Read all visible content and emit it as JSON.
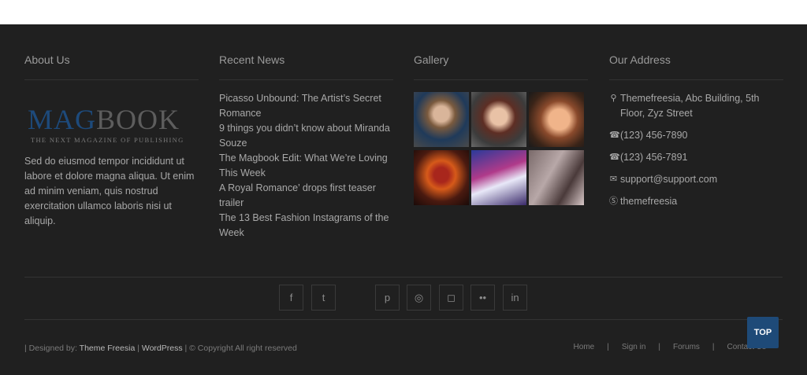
{
  "about": {
    "title": "About Us",
    "logo": {
      "part1": "MAG",
      "part2": "BOOK",
      "tagline": "THE NEXT MAGAZINE OF PUBLISHING"
    },
    "text": "Sed do eiusmod tempor incididunt ut labore et dolore magna aliqua. Ut enim ad minim veniam, quis nostrud exercitation ullamco laboris nisi ut aliquip."
  },
  "news": {
    "title": "Recent News",
    "items": [
      "Picasso Unbound: The Artist’s Secret Romance",
      "9 things you didn’t know about Miranda Souze",
      "The Magbook Edit: What We’re Loving This Week",
      "A Royal Romance’ drops first teaser trailer",
      "The 13 Best Fashion Instagrams of the Week"
    ]
  },
  "gallery": {
    "title": "Gallery"
  },
  "address": {
    "title": "Our Address",
    "lines": [
      {
        "icon": "map-marker-icon",
        "text": "Themefreesia, Abc Building, 5th Floor, Zyz Street"
      },
      {
        "icon": "phone-icon",
        "text": "(123) 456-7890"
      },
      {
        "icon": "phone-icon",
        "text": "(123) 456-7891"
      },
      {
        "icon": "envelope-icon",
        "text": "support@support.com"
      },
      {
        "icon": "skype-icon",
        "text": "themefreesia"
      }
    ]
  },
  "social": [
    {
      "icon": "facebook-icon",
      "glyph": "f"
    },
    {
      "icon": "twitter-icon",
      "glyph": "t"
    },
    {
      "icon": "pinterest-icon",
      "glyph": "p"
    },
    {
      "icon": "dribbble-icon",
      "glyph": "◎"
    },
    {
      "icon": "instagram-icon",
      "glyph": "◻"
    },
    {
      "icon": "flickr-icon",
      "glyph": "••"
    },
    {
      "icon": "linkedin-icon",
      "glyph": "in"
    }
  ],
  "bottom": {
    "prefix": "| Designed by:",
    "theme": "Theme Freesia",
    "mid": " | ",
    "wordpress": "WordPress",
    "copyright": " | © Copyright All right reserved",
    "nav": [
      "Home",
      "Sign in",
      "Forums",
      "Contact Us"
    ],
    "separator": "|"
  },
  "top_button": "TOP",
  "colors": {
    "footer_bg": "#202020",
    "accent": "#1e4a78"
  }
}
